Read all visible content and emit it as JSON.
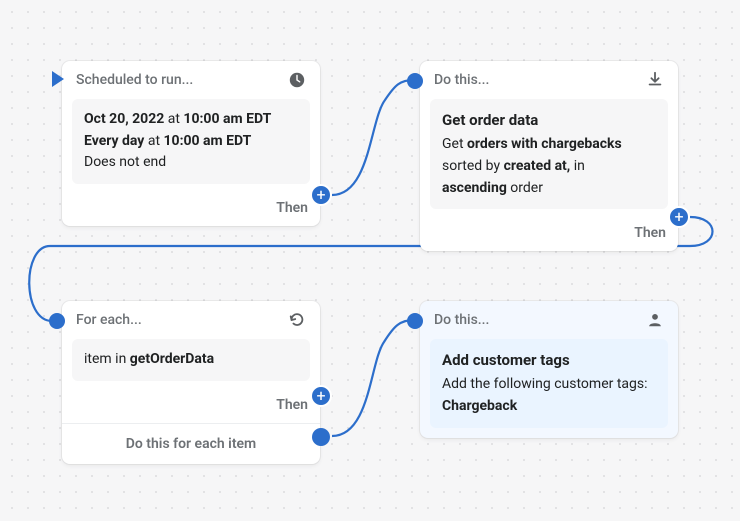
{
  "nodes": {
    "trigger": {
      "header": "Scheduled to run...",
      "linePrefix1": "Oct 20, 2022",
      "lineMid1": " at ",
      "lineBold1b": "10:00 am EDT",
      "linePrefix2": "Every day",
      "lineMid2": " at ",
      "lineBold2b": "10:00 am EDT",
      "line3": "Does not end",
      "footer": "Then"
    },
    "getOrder": {
      "header": "Do this...",
      "title": "Get order data",
      "sub1a": "Get ",
      "sub1b": "orders with chargebacks",
      "sub2a": "sorted by ",
      "sub2b": "created at,",
      "sub2c": " in ",
      "sub3a": "ascending",
      "sub3b": " order",
      "footer": "Then"
    },
    "foreach": {
      "header": "For each...",
      "bodyA": "item in ",
      "bodyB": "getOrderData",
      "footer": "Then",
      "bottom": "Do this for each item"
    },
    "addTags": {
      "header": "Do this...",
      "title": "Add customer tags",
      "sub": "Add the following customer tags:",
      "tag": "Chargeback"
    }
  }
}
